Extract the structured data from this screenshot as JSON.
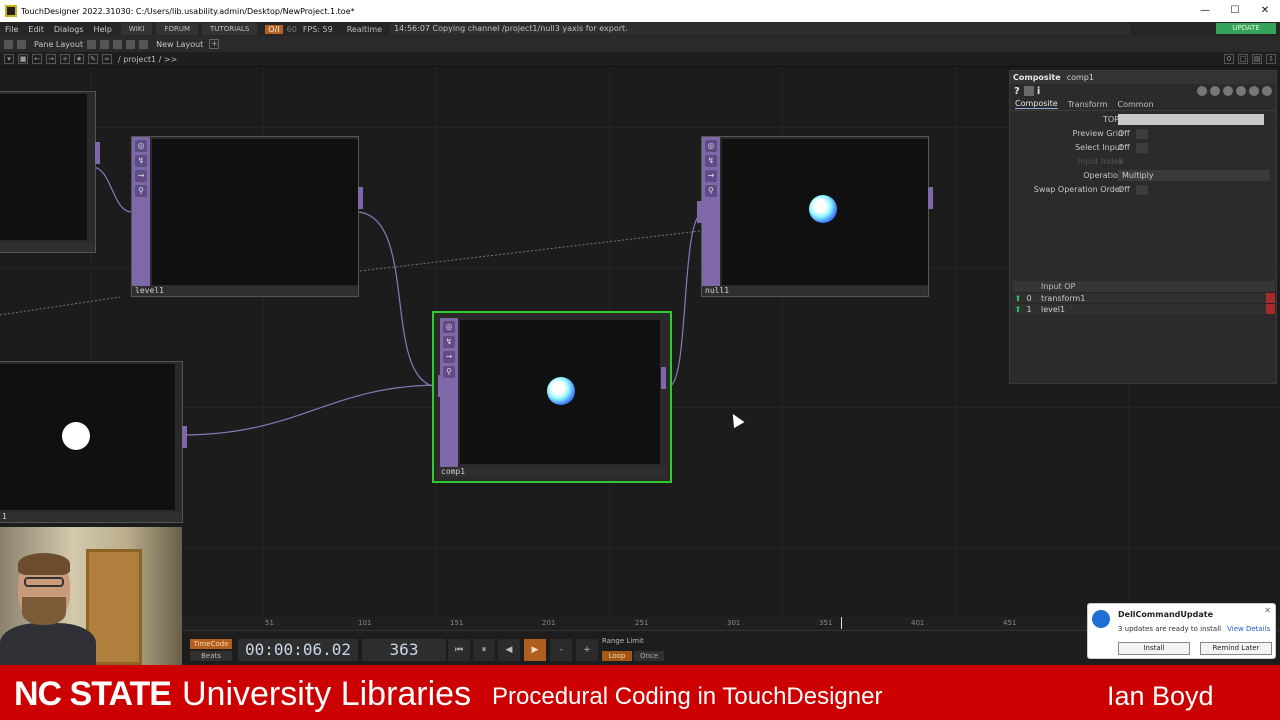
{
  "window": {
    "title": "TouchDesigner 2022.31030: C:/Users/lib.usability.admin/Desktop/NewProject.1.toe*",
    "controls": [
      "—",
      "☐",
      "✕"
    ]
  },
  "menu": {
    "items": [
      "File",
      "Edit",
      "Dialogs",
      "Help"
    ],
    "wiki": "WIKI",
    "forum": "FORUM",
    "tutorials": "TUTORIALS",
    "oi": "O/I",
    "tempo": "60",
    "fps": "FPS:  59",
    "realtime": "Realtime",
    "status": "14:56:07 Copying channel /project1/null3 yaxis for export.",
    "update": "UPDATE"
  },
  "panebar": {
    "pane_layout": "Pane Layout",
    "new_layout": "New Layout",
    "plus": "+"
  },
  "pathbar": {
    "path": "/  project1  /  >>",
    "right_num": "0"
  },
  "nodes": {
    "level1": "level1",
    "null1": "null1",
    "comp1": "comp1",
    "left_bottom": "1"
  },
  "params": {
    "op_type": "Composite",
    "op_name": "comp1",
    "help_glyph": "?",
    "info_glyph": "i",
    "tabs": [
      "Composite",
      "Transform",
      "Common"
    ],
    "tops_label": "TOPs",
    "preview_grid_label": "Preview Grid",
    "preview_grid_value": "Off",
    "select_input_label": "Select Input",
    "select_input_value": "Off",
    "input_index_label": "Input Index",
    "input_index_value": "0",
    "operation_label": "Operation",
    "operation_value": "Multiply",
    "swap_label": "Swap Operation Order",
    "swap_value": "Off",
    "input_table_header": "Input OP",
    "inputs": [
      {
        "index": "0",
        "name": "transform1"
      },
      {
        "index": "1",
        "name": "level1"
      }
    ]
  },
  "timeline": {
    "ruler": [
      "51",
      "101",
      "151",
      "201",
      "251",
      "301",
      "351",
      "401",
      "451"
    ],
    "timecode_btn": "TimeCode",
    "beats_btn": "Beats",
    "timecode": "00:00:06.02",
    "frame": "363",
    "controls": [
      "⏮",
      "⏸",
      "◀",
      "▶",
      "-",
      "+"
    ],
    "range_limit": "Range Limit",
    "loop": "Loop",
    "once": "Once"
  },
  "toast": {
    "title": "DellCommandUpdate",
    "message": "3 updates are ready to install",
    "link": "View Details",
    "install": "Install",
    "remind": "Remind Later",
    "close": "✕"
  },
  "banner": {
    "ncstate": "NC STATE",
    "libraries": "University Libraries",
    "course": "Procedural Coding in TouchDesigner",
    "author": "Ian Boyd"
  },
  "colors": {
    "operator_purple": "#7e68a8",
    "selection_green": "#2ecc2e",
    "banner_red": "#cc0000",
    "update_green": "#35a35a",
    "timecode_orange": "#b45f1d"
  }
}
